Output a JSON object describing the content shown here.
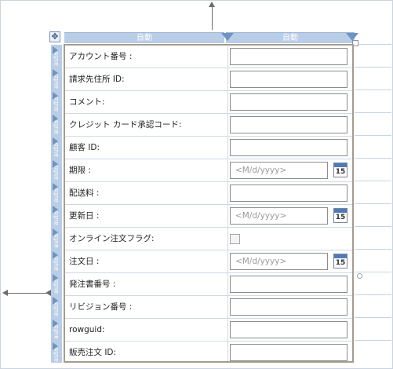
{
  "columns": [
    {
      "label": "自動"
    },
    {
      "label": "自動"
    }
  ],
  "row_marker_text": "auto",
  "rows": [
    {
      "label": "アカウント番号 :",
      "kind": "text"
    },
    {
      "label": "請求先住所 ID:",
      "kind": "text"
    },
    {
      "label": "コメント:",
      "kind": "text"
    },
    {
      "label": "クレジット カード承認コード:",
      "kind": "text"
    },
    {
      "label": "顧客 ID:",
      "kind": "text"
    },
    {
      "label": "期限 :",
      "kind": "date",
      "placeholder": "<M/d/yyyy>",
      "calendar_day": "15"
    },
    {
      "label": "配送料 :",
      "kind": "text"
    },
    {
      "label": "更新日 :",
      "kind": "date",
      "placeholder": "<M/d/yyyy>",
      "calendar_day": "15"
    },
    {
      "label": "オンライン注文フラグ:",
      "kind": "checkbox",
      "checked": false
    },
    {
      "label": "注文日 :",
      "kind": "date",
      "placeholder": "<M/d/yyyy>",
      "calendar_day": "15"
    },
    {
      "label": "発注書番号 :",
      "kind": "text"
    },
    {
      "label": "リビジョン番号 :",
      "kind": "text"
    },
    {
      "label": "rowguid:",
      "kind": "text"
    },
    {
      "label": "販売注文 ID:",
      "kind": "text"
    }
  ],
  "colors": {
    "header_bar": "#b9cde6",
    "accent_triangle": "#6f93c2",
    "table_border": "#a59c8f",
    "calendar_top": "#4d7bb7"
  },
  "icons": {
    "move_handle": "move-cross-icon",
    "calendar": "calendar-icon",
    "column_arrow": "column-dropdown-icon",
    "row_arrow": "row-select-icon"
  }
}
